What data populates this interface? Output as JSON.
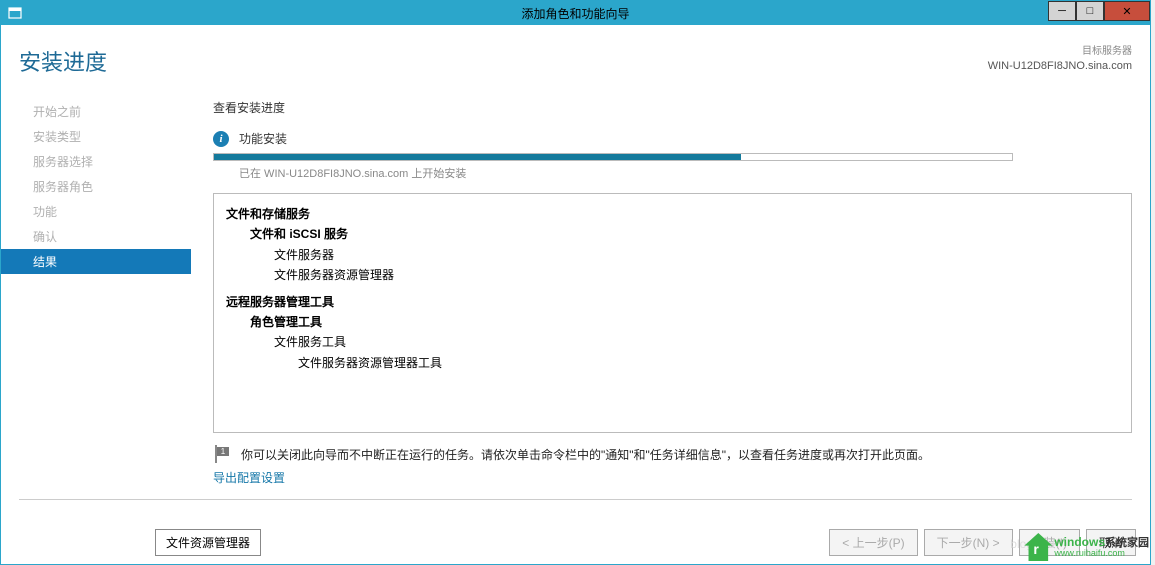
{
  "titlebar": {
    "title": "添加角色和功能向导"
  },
  "header": {
    "page_title": "安装进度",
    "target_label": "目标服务器",
    "target_server": "WIN-U12D8FI8JNO.sina.com"
  },
  "sidebar": {
    "items": [
      {
        "label": "开始之前"
      },
      {
        "label": "安装类型"
      },
      {
        "label": "服务器选择"
      },
      {
        "label": "服务器角色"
      },
      {
        "label": "功能"
      },
      {
        "label": "确认"
      },
      {
        "label": "结果"
      }
    ]
  },
  "main": {
    "section_heading": "查看安装进度",
    "status_text": "功能安装",
    "progress_caption": "已在 WIN-U12D8FI8JNO.sina.com 上开始安装",
    "progress_percent": 66,
    "features": {
      "g1": {
        "l0": "文件和存储服务",
        "l1": "文件和 iSCSI 服务",
        "l2a": "文件服务器",
        "l2b": "文件服务器资源管理器"
      },
      "g2": {
        "l0": "远程服务器管理工具",
        "l1": "角色管理工具",
        "l2": "文件服务工具",
        "l3": "文件服务器资源管理器工具"
      }
    },
    "hint_text": "你可以关闭此向导而不中断正在运行的任务。请依次单击命令栏中的\"通知\"和\"任务详细信息\"，以查看任务进度或再次打开此页面。",
    "export_link": "导出配置设置"
  },
  "footer": {
    "left_button": "文件资源管理器",
    "prev": "< 上一步(P)",
    "next": "下一步(N) >",
    "install": "安装(I)",
    "cancel": "取消"
  },
  "watermark": {
    "brand": "windows",
    "suffix": "系统家园",
    "url": "www.ruihaifu.com"
  },
  "faded_text": "blog.csd"
}
